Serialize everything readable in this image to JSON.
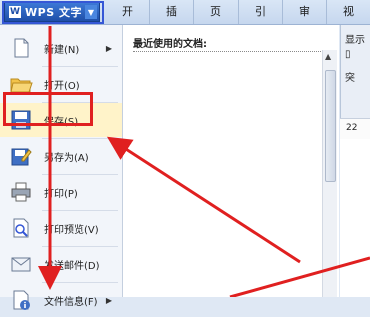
{
  "app": {
    "title": "WPS 文字",
    "logo": "W"
  },
  "ribbon_tabs": [
    "开始",
    "插入",
    "页面布局",
    "引用",
    "审阅",
    "视图"
  ],
  "file_menu": {
    "items": [
      {
        "label": "新建(N)",
        "icon": "new-document-icon",
        "has_submenu": true
      },
      {
        "label": "打开(O)",
        "icon": "open-folder-icon",
        "has_submenu": false
      },
      {
        "label": "保存(S)",
        "icon": "save-disk-icon",
        "has_submenu": false
      },
      {
        "label": "另存为(A)",
        "icon": "save-as-icon",
        "has_submenu": false
      },
      {
        "label": "打印(P)",
        "icon": "printer-icon",
        "has_submenu": false
      },
      {
        "label": "打印预览(V)",
        "icon": "print-preview-icon",
        "has_submenu": false
      },
      {
        "label": "发送邮件(D)",
        "icon": "send-mail-icon",
        "has_submenu": false
      },
      {
        "label": "文件信息(F)",
        "icon": "file-info-icon",
        "has_submenu": true
      }
    ]
  },
  "recent_panel": {
    "title": "最近使用的文档:"
  },
  "right_pane": {
    "line1": "显示",
    "line3": "突",
    "ruler": "22"
  },
  "colors": {
    "highlight": "#e02020",
    "title_outline": "#3557d6",
    "accent": "#1f4fa8"
  }
}
